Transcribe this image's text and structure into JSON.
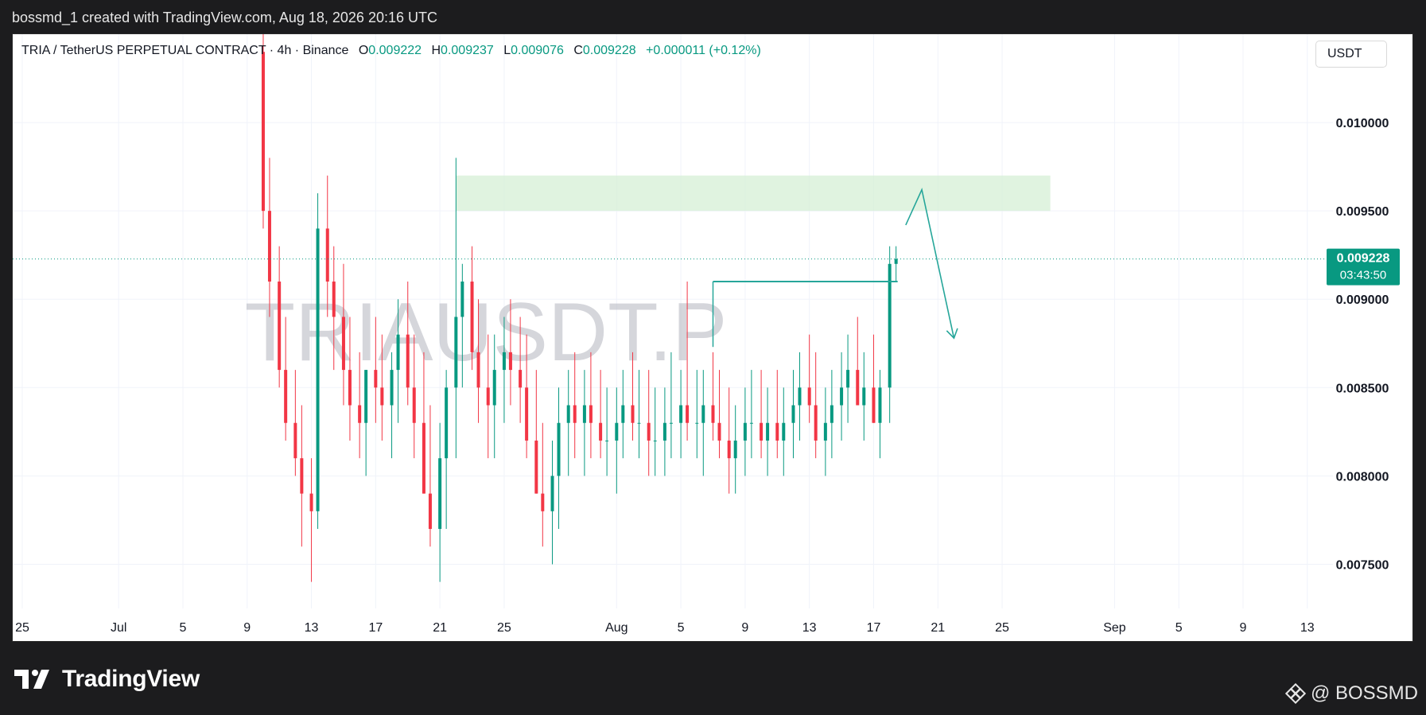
{
  "header": {
    "publisher_line": "bossmd_1 created with TradingView.com, Aug 18, 2026 20:16 UTC"
  },
  "legend": {
    "symbol_line": "TRIA / TetherUS PERPETUAL CONTRACT · 4h · Binance",
    "o_label": "O",
    "o_value": "0.009222",
    "h_label": "H",
    "h_value": "0.009237",
    "l_label": "L",
    "l_value": "0.009076",
    "c_label": "C",
    "c_value": "0.009228",
    "change": "+0.000011 (+0.12%)"
  },
  "currency_button": "USDT",
  "footer": {
    "brand": "TradingView",
    "author": "@ BOSSMD"
  },
  "colors": {
    "up": "#089981",
    "down": "#f23645",
    "zone": "#d6efd6",
    "annotation": "#26a69a"
  },
  "chart_data": {
    "type": "candlestick",
    "watermark": "TRIAUSDT.P",
    "price_axis": {
      "ticks": [
        "0.010000",
        "0.009500",
        "0.009000",
        "0.008500",
        "0.008000",
        "0.007500"
      ],
      "tick_values": [
        0.01,
        0.0095,
        0.009,
        0.0085,
        0.008,
        0.0075
      ],
      "ylim": [
        0.00725,
        0.0105
      ]
    },
    "time_axis": {
      "labels": [
        "25",
        "Jul",
        "5",
        "9",
        "13",
        "17",
        "21",
        "25",
        "Aug",
        "5",
        "9",
        "13",
        "17",
        "21",
        "25",
        "Sep",
        "5",
        "9",
        "13"
      ],
      "label_dates": [
        "2026-06-25",
        "2026-07-01",
        "2026-07-05",
        "2026-07-09",
        "2026-07-13",
        "2026-07-17",
        "2026-07-21",
        "2026-07-25",
        "2026-08-01",
        "2026-08-05",
        "2026-08-09",
        "2026-08-13",
        "2026-08-17",
        "2026-08-21",
        "2026-08-25",
        "2026-09-01",
        "2026-09-05",
        "2026-09-09",
        "2026-09-13"
      ],
      "xlim": [
        "2026-06-25",
        "2026-09-14"
      ]
    },
    "last_price": {
      "value": "0.009228",
      "countdown": "03:43:50"
    },
    "series": [
      {
        "x": [
          "2026-07-10",
          "2026-07-10",
          "2026-07-11",
          "2026-07-11",
          "2026-07-12",
          "2026-07-12",
          "2026-07-13",
          "2026-07-13",
          "2026-07-14",
          "2026-07-14",
          "2026-07-15",
          "2026-07-15",
          "2026-07-16",
          "2026-07-16",
          "2026-07-17",
          "2026-07-17",
          "2026-07-18",
          "2026-07-18",
          "2026-07-19",
          "2026-07-19",
          "2026-07-20",
          "2026-07-20",
          "2026-07-21",
          "2026-07-21",
          "2026-07-22",
          "2026-07-22",
          "2026-07-23",
          "2026-07-23",
          "2026-07-24",
          "2026-07-24",
          "2026-07-25",
          "2026-07-25",
          "2026-07-26",
          "2026-07-26",
          "2026-07-27",
          "2026-07-27",
          "2026-07-28",
          "2026-07-28",
          "2026-07-29",
          "2026-07-29",
          "2026-07-30",
          "2026-07-30",
          "2026-07-31",
          "2026-07-31",
          "2026-08-01",
          "2026-08-01",
          "2026-08-02",
          "2026-08-02",
          "2026-08-03",
          "2026-08-03",
          "2026-08-04",
          "2026-08-04",
          "2026-08-05",
          "2026-08-05",
          "2026-08-06",
          "2026-08-06",
          "2026-08-07",
          "2026-08-07",
          "2026-08-08",
          "2026-08-08",
          "2026-08-09",
          "2026-08-09",
          "2026-08-10",
          "2026-08-10",
          "2026-08-11",
          "2026-08-11",
          "2026-08-12",
          "2026-08-12",
          "2026-08-13",
          "2026-08-13",
          "2026-08-14",
          "2026-08-14",
          "2026-08-15",
          "2026-08-15",
          "2026-08-16",
          "2026-08-16",
          "2026-08-17",
          "2026-08-17",
          "2026-08-18",
          "2026-08-18"
        ],
        "open": [
          0.0104,
          0.0095,
          0.0091,
          0.0086,
          0.0083,
          0.0081,
          0.0079,
          0.0078,
          0.0094,
          0.0091,
          0.0089,
          0.0086,
          0.0084,
          0.0083,
          0.0086,
          0.0085,
          0.0084,
          0.0086,
          0.0088,
          0.0085,
          0.0083,
          0.0079,
          0.0077,
          0.0081,
          0.0085,
          0.0089,
          0.0091,
          0.0087,
          0.0085,
          0.0084,
          0.0086,
          0.0087,
          0.0086,
          0.0085,
          0.0082,
          0.0079,
          0.0078,
          0.008,
          0.0083,
          0.0084,
          0.0083,
          0.0084,
          0.0083,
          0.0082,
          0.0082,
          0.0083,
          0.0084,
          0.0083,
          0.0083,
          0.0082,
          0.0082,
          0.0083,
          0.0083,
          0.0084,
          0.0083,
          0.0083,
          0.0084,
          0.0083,
          0.0082,
          0.0081,
          0.0082,
          0.0083,
          0.0083,
          0.0082,
          0.0083,
          0.0082,
          0.0083,
          0.0084,
          0.0085,
          0.0084,
          0.0082,
          0.0083,
          0.0084,
          0.0085,
          0.0086,
          0.0084,
          0.0085,
          0.0083,
          0.0085,
          0.0092
        ],
        "high": [
          0.0105,
          0.0098,
          0.0093,
          0.0089,
          0.0086,
          0.0084,
          0.0081,
          0.0096,
          0.0097,
          0.0093,
          0.0092,
          0.0089,
          0.0087,
          0.0086,
          0.0089,
          0.0088,
          0.0087,
          0.009,
          0.0091,
          0.0088,
          0.0087,
          0.0084,
          0.0083,
          0.0086,
          0.0098,
          0.0092,
          0.0093,
          0.009,
          0.0088,
          0.0088,
          0.0089,
          0.009,
          0.0089,
          0.0088,
          0.0086,
          0.0083,
          0.0082,
          0.0085,
          0.0086,
          0.0087,
          0.0086,
          0.0087,
          0.0086,
          0.0085,
          0.0085,
          0.0086,
          0.0087,
          0.0086,
          0.0086,
          0.0085,
          0.0085,
          0.0087,
          0.0086,
          0.0091,
          0.0086,
          0.0086,
          0.0087,
          0.0086,
          0.0085,
          0.0084,
          0.0085,
          0.0086,
          0.0086,
          0.0085,
          0.0086,
          0.0085,
          0.0086,
          0.0087,
          0.0088,
          0.0087,
          0.0085,
          0.0086,
          0.0087,
          0.0088,
          0.0089,
          0.0087,
          0.0088,
          0.0086,
          0.0093,
          0.0093
        ],
        "low": [
          0.0094,
          0.0089,
          0.0085,
          0.0082,
          0.008,
          0.0076,
          0.0074,
          0.0077,
          0.0089,
          0.0086,
          0.0084,
          0.0082,
          0.0081,
          0.008,
          0.0083,
          0.0082,
          0.0081,
          0.0083,
          0.0084,
          0.0081,
          0.0079,
          0.0076,
          0.0074,
          0.0077,
          0.0081,
          0.0085,
          0.0086,
          0.0083,
          0.0081,
          0.0081,
          0.0083,
          0.0084,
          0.0083,
          0.0081,
          0.0079,
          0.0076,
          0.0075,
          0.0077,
          0.008,
          0.0081,
          0.008,
          0.0081,
          0.0081,
          0.008,
          0.0079,
          0.0081,
          0.0082,
          0.0081,
          0.008,
          0.008,
          0.008,
          0.0081,
          0.0081,
          0.0082,
          0.0081,
          0.008,
          0.0082,
          0.0081,
          0.0079,
          0.0079,
          0.008,
          0.0081,
          0.0081,
          0.008,
          0.0081,
          0.008,
          0.0081,
          0.0082,
          0.0083,
          0.0081,
          0.008,
          0.0081,
          0.0082,
          0.0083,
          0.0084,
          0.0082,
          0.0083,
          0.0081,
          0.0083,
          0.0091
        ],
        "close": [
          0.0095,
          0.0091,
          0.0086,
          0.0083,
          0.0081,
          0.0079,
          0.0078,
          0.0094,
          0.0091,
          0.0089,
          0.0086,
          0.0084,
          0.0083,
          0.0086,
          0.0085,
          0.0084,
          0.0086,
          0.0088,
          0.0085,
          0.0083,
          0.0079,
          0.0077,
          0.0081,
          0.0085,
          0.0089,
          0.0091,
          0.0087,
          0.0085,
          0.0084,
          0.0086,
          0.0087,
          0.0086,
          0.0085,
          0.0082,
          0.0079,
          0.0078,
          0.008,
          0.0083,
          0.0084,
          0.0083,
          0.0084,
          0.0083,
          0.0082,
          0.0082,
          0.0083,
          0.0084,
          0.0083,
          0.0083,
          0.0082,
          0.0082,
          0.0083,
          0.0083,
          0.0084,
          0.0083,
          0.0083,
          0.0084,
          0.0083,
          0.0082,
          0.0081,
          0.0082,
          0.0083,
          0.0083,
          0.0082,
          0.0083,
          0.0082,
          0.0083,
          0.0084,
          0.0085,
          0.0084,
          0.0082,
          0.0083,
          0.0084,
          0.0085,
          0.0086,
          0.0084,
          0.0085,
          0.0083,
          0.0085,
          0.0092,
          0.009228
        ]
      }
    ],
    "annotations": {
      "resistance_zone": {
        "x_from": "2026-07-22",
        "x_to": "2026-08-28",
        "y_from": 0.0095,
        "y_to": 0.0097
      },
      "horizontal_line": {
        "x_from": "2026-08-07",
        "x_to": "2026-08-18",
        "y": 0.0091
      },
      "vertical_line": {
        "x": "2026-08-07",
        "y_from": 0.00873,
        "y_to": 0.0091
      },
      "projection_path": [
        {
          "x": "2026-08-19",
          "y": 0.00942
        },
        {
          "x": "2026-08-20",
          "y": 0.00962
        },
        {
          "x": "2026-08-22",
          "y": 0.00878
        }
      ]
    }
  }
}
